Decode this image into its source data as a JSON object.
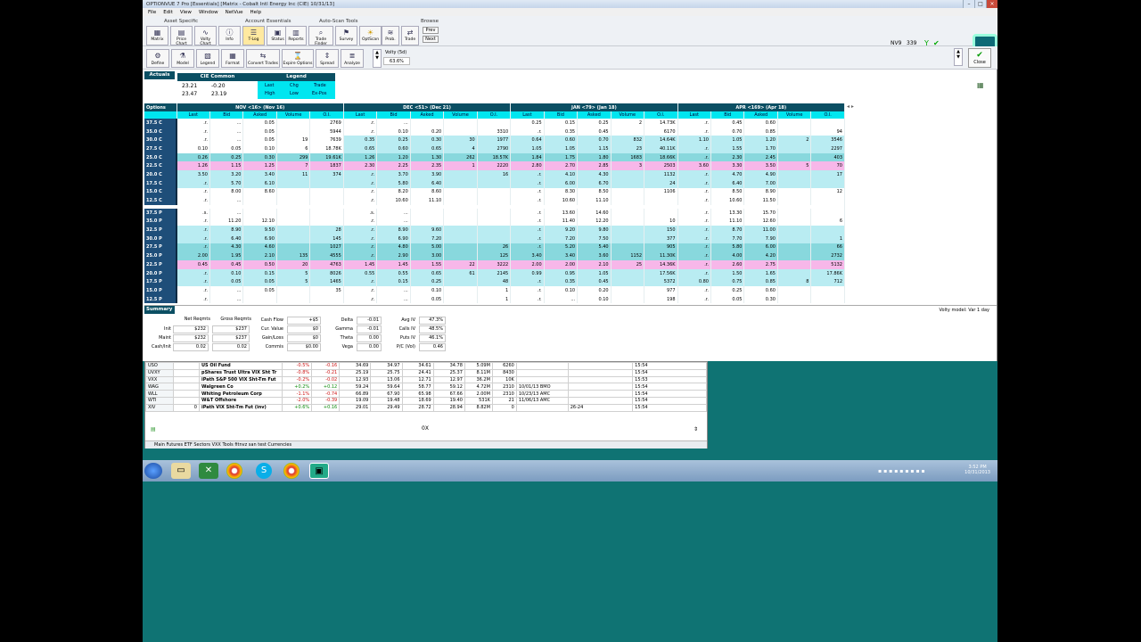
{
  "app": {
    "title": "OPTIONVUE 7 Pro  [Essentials]  [Matrix - Cobalt Intl Energy Inc (CIE)  10/31/13]"
  },
  "menu": [
    "File",
    "Edit",
    "View",
    "Window",
    "NetVue",
    "Help"
  ],
  "toolbar": {
    "groups": [
      "Asset Specific",
      "Account Essentials",
      "Auto-Scan Tools",
      "Browse"
    ],
    "buttons": [
      "Matrix",
      "Price Chart",
      "Volty Chart",
      "Info",
      "T-Log",
      "Status",
      "Reports",
      "Trade Finder",
      "Survey",
      "OptScan",
      "Prob.",
      "Trade"
    ],
    "browse": [
      "Prev",
      "Next"
    ],
    "nv": "NV9",
    "nv_val": "339"
  },
  "toolbar2": {
    "buttons": [
      "Define",
      "Model",
      "Legend",
      "Format",
      "Convert Trades",
      "Expire Options",
      "Spread",
      "Analyze"
    ],
    "volty_label": "Volty (5d)",
    "volty_value": "63.6%",
    "close": "Close"
  },
  "actuals": {
    "label": "Actuals",
    "symbol": "CIE Common",
    "legend": "Legend",
    "r1": [
      "23.21",
      "-0.20"
    ],
    "r2": [
      "23.47",
      "23.19"
    ],
    "leg": [
      [
        "Last",
        "Chg",
        "Trade"
      ],
      [
        "High",
        "Low",
        "Ex-Pos"
      ]
    ]
  },
  "options": {
    "label": "Options",
    "months": [
      "NOV <16> (Nov 16)",
      "DEC <51> (Dec 21)",
      "JAN <79> (Jan 18)",
      "APR <169> (Apr 18)"
    ],
    "cols": [
      "Last",
      "Bid",
      "Asked",
      "Volume",
      "O.I."
    ],
    "calls": [
      [
        "37.5 C",
        [
          ".r.",
          "...",
          "0.05",
          "",
          "2769"
        ],
        [
          ".r.",
          "...",
          "",
          "",
          ""
        ],
        [
          "0.25",
          "0.15",
          "0.25",
          "2",
          "14.73K"
        ],
        [
          ".r.",
          "0.45",
          "0.60",
          "",
          ""
        ]
      ],
      [
        "35.0 C",
        [
          ".r.",
          "...",
          "0.05",
          "",
          "5944"
        ],
        [
          ".r.",
          "0.10",
          "0.20",
          "",
          "3310"
        ],
        [
          ".r.",
          "0.35",
          "0.45",
          "",
          "6170"
        ],
        [
          ".r.",
          "0.70",
          "0.85",
          "",
          "94"
        ]
      ],
      [
        "30.0 C",
        [
          ".r.",
          "...",
          "0.05",
          "19",
          "7639"
        ],
        [
          "0.35",
          "0.25",
          "0.30",
          "30",
          "1977"
        ],
        [
          "0.64",
          "0.60",
          "0.70",
          "832",
          "14.64K"
        ],
        [
          "1.10",
          "1.05",
          "1.20",
          "2",
          "3546"
        ]
      ],
      [
        "27.5 C",
        [
          "0.10",
          "0.05",
          "0.10",
          "6",
          "18.78K"
        ],
        [
          "0.65",
          "0.60",
          "0.65",
          "4",
          "2790"
        ],
        [
          "1.05",
          "1.05",
          "1.15",
          "23",
          "40.11K"
        ],
        [
          ".r.",
          "1.55",
          "1.70",
          "",
          "2297"
        ]
      ],
      [
        "25.0 C",
        [
          "0.26",
          "0.25",
          "0.30",
          "299",
          "19.61K"
        ],
        [
          "1.26",
          "1.20",
          "1.30",
          "262",
          "18.57K"
        ],
        [
          "1.84",
          "1.75",
          "1.80",
          "1683",
          "18.66K"
        ],
        [
          ".r.",
          "2.30",
          "2.45",
          "",
          "403"
        ]
      ],
      [
        "22.5 C",
        [
          "1.26",
          "1.15",
          "1.25",
          "7",
          "1837"
        ],
        [
          "2.30",
          "2.25",
          "2.35",
          "1",
          "2220"
        ],
        [
          "2.80",
          "2.70",
          "2.85",
          "3",
          "2503"
        ],
        [
          "3.60",
          "3.30",
          "3.50",
          "5",
          "70"
        ]
      ],
      [
        "20.0 C",
        [
          "3.50",
          "3.20",
          "3.40",
          "11",
          "374"
        ],
        [
          ".r.",
          "3.70",
          "3.90",
          "",
          "16"
        ],
        [
          ".r.",
          "4.10",
          "4.30",
          "",
          "1132"
        ],
        [
          ".r.",
          "4.70",
          "4.90",
          "",
          "17"
        ]
      ],
      [
        "17.5 C",
        [
          ".r.",
          "5.70",
          "6.10",
          "",
          ""
        ],
        [
          ".r.",
          "5.80",
          "6.40",
          "",
          ""
        ],
        [
          ".r.",
          "6.00",
          "6.70",
          "",
          "24"
        ],
        [
          ".r.",
          "6.40",
          "7.00",
          "",
          ""
        ]
      ],
      [
        "15.0 C",
        [
          ".r.",
          "8.00",
          "8.60",
          "",
          ""
        ],
        [
          ".r.",
          "8.20",
          "8.60",
          "",
          ""
        ],
        [
          ".r.",
          "8.30",
          "8.50",
          "",
          "1106"
        ],
        [
          ".r.",
          "8.50",
          "8.90",
          "",
          "12"
        ]
      ],
      [
        "12.5 C",
        [
          ".r.",
          "...",
          "",
          "",
          ""
        ],
        [
          ".r.",
          "10.60",
          "11.10",
          "",
          ""
        ],
        [
          ".r.",
          "10.60",
          "11.10",
          "",
          ""
        ],
        [
          ".r.",
          "10.60",
          "11.50",
          "",
          ""
        ]
      ]
    ],
    "puts": [
      [
        "37.5 P",
        [
          ".s.",
          "...",
          "",
          "",
          ""
        ],
        [
          ".s.",
          "...",
          "",
          "",
          ""
        ],
        [
          ".r.",
          "13.60",
          "14.60",
          "",
          ""
        ],
        [
          ".r.",
          "13.30",
          "15.70",
          "",
          ""
        ]
      ],
      [
        "35.0 P",
        [
          ".r.",
          "11.20",
          "12.10",
          "",
          ""
        ],
        [
          ".r.",
          "...",
          "",
          "",
          ""
        ],
        [
          ".r.",
          "11.40",
          "12.20",
          "",
          "10"
        ],
        [
          ".r.",
          "11.10",
          "12.60",
          "",
          "6"
        ]
      ],
      [
        "32.5 P",
        [
          ".r.",
          "8.90",
          "9.50",
          "",
          "28"
        ],
        [
          ".r.",
          "8.90",
          "9.60",
          "",
          ""
        ],
        [
          ".r.",
          "9.20",
          "9.80",
          "",
          "150"
        ],
        [
          ".r.",
          "8.70",
          "11.00",
          "",
          ""
        ]
      ],
      [
        "30.0 P",
        [
          ".r.",
          "6.40",
          "6.90",
          "",
          "145"
        ],
        [
          ".r.",
          "6.90",
          "7.20",
          "",
          ""
        ],
        [
          ".r.",
          "7.20",
          "7.50",
          "",
          "377"
        ],
        [
          ".r.",
          "7.70",
          "7.90",
          "",
          "1"
        ]
      ],
      [
        "27.5 P",
        [
          ".r.",
          "4.30",
          "4.60",
          "",
          "1027"
        ],
        [
          ".r.",
          "4.80",
          "5.00",
          "",
          "26"
        ],
        [
          ".r.",
          "5.20",
          "5.40",
          "",
          "905"
        ],
        [
          ".r.",
          "5.80",
          "6.00",
          "",
          "66"
        ]
      ],
      [
        "25.0 P",
        [
          "2.00",
          "1.95",
          "2.10",
          "135",
          "4555"
        ],
        [
          ".r.",
          "2.90",
          "3.00",
          "",
          "125"
        ],
        [
          "3.40",
          "3.40",
          "3.60",
          "1152",
          "11.30K"
        ],
        [
          ".r.",
          "4.00",
          "4.20",
          "",
          "2732"
        ]
      ],
      [
        "22.5 P",
        [
          "0.45",
          "0.45",
          "0.50",
          "20",
          "4763"
        ],
        [
          "1.45",
          "1.45",
          "1.55",
          "22",
          "3222"
        ],
        [
          "2.00",
          "2.00",
          "2.10",
          "25",
          "14.36K"
        ],
        [
          ".r.",
          "2.60",
          "2.75",
          "",
          "5132"
        ]
      ],
      [
        "20.0 P",
        [
          ".r.",
          "0.10",
          "0.15",
          "5",
          "8026"
        ],
        [
          "0.55",
          "0.55",
          "0.65",
          "61",
          "2145"
        ],
        [
          "0.99",
          "0.95",
          "1.05",
          "",
          "17.56K"
        ],
        [
          ".r.",
          "1.50",
          "1.65",
          "",
          "17.86K"
        ]
      ],
      [
        "17.5 P",
        [
          ".r.",
          "0.05",
          "0.05",
          "5",
          "1465"
        ],
        [
          ".r.",
          "0.15",
          "0.25",
          "",
          "48"
        ],
        [
          ".r.",
          "0.35",
          "0.45",
          "",
          "5372"
        ],
        [
          "0.80",
          "0.75",
          "0.85",
          "8",
          "712"
        ]
      ],
      [
        "15.0 P",
        [
          ".r.",
          "...",
          "0.05",
          "",
          "35"
        ],
        [
          ".r.",
          "...",
          "0.10",
          "",
          "1"
        ],
        [
          ".r.",
          "0.10",
          "0.20",
          "",
          "977"
        ],
        [
          ".r.",
          "0.25",
          "0.60",
          "",
          ""
        ]
      ],
      [
        "12.5 P",
        [
          ".r.",
          "...",
          "",
          "",
          ""
        ],
        [
          ".r.",
          "...",
          "0.05",
          "",
          "1"
        ],
        [
          ".r.",
          "...",
          "0.10",
          "",
          "198"
        ],
        [
          ".r.",
          "0.05",
          "0.30",
          "",
          ""
        ]
      ]
    ]
  },
  "summary": {
    "label": "Summary",
    "volty_model": "Volty model: Var 1 day",
    "hdr": [
      "Net Reqmts",
      "Gross Reqmts"
    ],
    "rows": [
      [
        "Init",
        "$232",
        "$237"
      ],
      [
        "Maint",
        "$232",
        "$237"
      ],
      [
        "Cash/Init",
        "0.02",
        "0.02"
      ]
    ],
    "cash": [
      [
        "Cash Flow",
        "+$5"
      ],
      [
        "Cur. Value",
        "$0"
      ],
      [
        "Gain/Loss",
        "$0"
      ],
      [
        "Commis",
        "$0.00"
      ]
    ],
    "greeks": [
      [
        "Delta",
        "-0.01"
      ],
      [
        "Gamma",
        "-0.01"
      ],
      [
        "Theta",
        "0.00"
      ],
      [
        "Vega",
        "0.00"
      ]
    ],
    "iv": [
      [
        "Avg IV",
        "47.3%"
      ],
      [
        "Calls IV",
        "48.5%"
      ],
      [
        "Puts IV",
        "46.1%"
      ],
      [
        "P/C (Vol)",
        "0.46"
      ]
    ]
  },
  "watchlist": {
    "rows": [
      [
        "USO",
        "",
        "US Oil Fund",
        "-0.5%",
        "-0.16",
        "34.69",
        "34.97",
        "34.61",
        "34.78",
        "5.09M",
        "6260",
        "",
        "",
        "15:54"
      ],
      [
        "UVXY",
        "",
        "pShares Trust Ultra VIX Sht Tr",
        "-0.8%",
        "-0.21",
        "25.19",
        "25.75",
        "24.41",
        "25.37",
        "8.11M",
        "8430",
        "",
        "",
        "15:54"
      ],
      [
        "VXX",
        "",
        "iPath S&P 500 VIX Sht-Tm Fut",
        "-0.2%",
        "-0.02",
        "12.93",
        "13.06",
        "12.71",
        "12.97",
        "36.2M",
        "10K",
        "",
        "",
        "15:53"
      ],
      [
        "WAG",
        "",
        "Walgreen Co",
        "+0.2%",
        "+0.12",
        "59.24",
        "59.64",
        "58.77",
        "59.12",
        "4.72M",
        "2310",
        "10/01/13 BMO",
        "",
        "15:54"
      ],
      [
        "WLL",
        "",
        "Whiting Petroleum Corp",
        "-1.1%",
        "-0.74",
        "66.89",
        "67.90",
        "65.98",
        "67.66",
        "2.00M",
        "2310",
        "10/23/13 AMC",
        "",
        "15:54"
      ],
      [
        "WTI",
        "",
        "W&T Offshore",
        "-2.0%",
        "-0.39",
        "19.09",
        "19.48",
        "18.69",
        "19.40",
        "531K",
        "21",
        "11/06/13 AMC",
        "",
        "15:54"
      ],
      [
        "XIV",
        "0",
        "iPath VIX Sht-Tm Fut (inv)",
        "+0.6%",
        "+0.16",
        "29.01",
        "29.49",
        "28.72",
        "28.94",
        "8.82M",
        "0",
        "",
        "26-24",
        "15:54"
      ]
    ],
    "footer": "0X",
    "tabs": "Main  Futures  ETF Sectors  VXX Tools  fitnvz san  test  Currencies"
  },
  "taskbar": {
    "time": "3:52 PM",
    "date": "10/31/2013"
  }
}
